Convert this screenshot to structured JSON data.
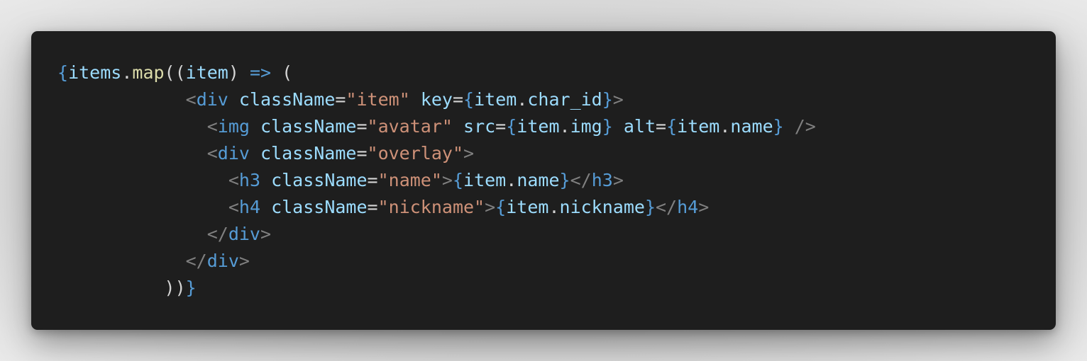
{
  "code_window": {
    "background": "#1e1e1e",
    "language": "jsx",
    "lines": [
      {
        "tokens": [
          {
            "text": "{",
            "type": "brace"
          },
          {
            "text": "items",
            "type": "var"
          },
          {
            "text": ".",
            "type": "punc"
          },
          {
            "text": "map",
            "type": "fn"
          },
          {
            "text": "((",
            "type": "punc"
          },
          {
            "text": "item",
            "type": "var"
          },
          {
            "text": ") ",
            "type": "punc"
          },
          {
            "text": "=>",
            "type": "arrow"
          },
          {
            "text": " (",
            "type": "punc"
          }
        ]
      },
      {
        "tokens": [
          {
            "text": "            ",
            "type": "ws"
          },
          {
            "text": "<",
            "type": "bracket"
          },
          {
            "text": "div",
            "type": "tag"
          },
          {
            "text": " ",
            "type": "ws"
          },
          {
            "text": "className",
            "type": "attr"
          },
          {
            "text": "=",
            "type": "punc"
          },
          {
            "text": "\"item\"",
            "type": "str"
          },
          {
            "text": " ",
            "type": "ws"
          },
          {
            "text": "key",
            "type": "attr"
          },
          {
            "text": "=",
            "type": "punc"
          },
          {
            "text": "{",
            "type": "brace"
          },
          {
            "text": "item",
            "type": "var"
          },
          {
            "text": ".",
            "type": "punc"
          },
          {
            "text": "char_id",
            "type": "var"
          },
          {
            "text": "}",
            "type": "brace"
          },
          {
            "text": ">",
            "type": "bracket"
          }
        ]
      },
      {
        "tokens": [
          {
            "text": "              ",
            "type": "ws"
          },
          {
            "text": "<",
            "type": "bracket"
          },
          {
            "text": "img",
            "type": "tag"
          },
          {
            "text": " ",
            "type": "ws"
          },
          {
            "text": "className",
            "type": "attr"
          },
          {
            "text": "=",
            "type": "punc"
          },
          {
            "text": "\"avatar\"",
            "type": "str"
          },
          {
            "text": " ",
            "type": "ws"
          },
          {
            "text": "src",
            "type": "attr"
          },
          {
            "text": "=",
            "type": "punc"
          },
          {
            "text": "{",
            "type": "brace"
          },
          {
            "text": "item",
            "type": "var"
          },
          {
            "text": ".",
            "type": "punc"
          },
          {
            "text": "img",
            "type": "var"
          },
          {
            "text": "}",
            "type": "brace"
          },
          {
            "text": " ",
            "type": "ws"
          },
          {
            "text": "alt",
            "type": "attr"
          },
          {
            "text": "=",
            "type": "punc"
          },
          {
            "text": "{",
            "type": "brace"
          },
          {
            "text": "item",
            "type": "var"
          },
          {
            "text": ".",
            "type": "punc"
          },
          {
            "text": "name",
            "type": "var"
          },
          {
            "text": "}",
            "type": "brace"
          },
          {
            "text": " />",
            "type": "bracket"
          }
        ]
      },
      {
        "tokens": [
          {
            "text": "              ",
            "type": "ws"
          },
          {
            "text": "<",
            "type": "bracket"
          },
          {
            "text": "div",
            "type": "tag"
          },
          {
            "text": " ",
            "type": "ws"
          },
          {
            "text": "className",
            "type": "attr"
          },
          {
            "text": "=",
            "type": "punc"
          },
          {
            "text": "\"overlay\"",
            "type": "str"
          },
          {
            "text": ">",
            "type": "bracket"
          }
        ]
      },
      {
        "tokens": [
          {
            "text": "                ",
            "type": "ws"
          },
          {
            "text": "<",
            "type": "bracket"
          },
          {
            "text": "h3",
            "type": "tag"
          },
          {
            "text": " ",
            "type": "ws"
          },
          {
            "text": "className",
            "type": "attr"
          },
          {
            "text": "=",
            "type": "punc"
          },
          {
            "text": "\"name\"",
            "type": "str"
          },
          {
            "text": ">",
            "type": "bracket"
          },
          {
            "text": "{",
            "type": "brace"
          },
          {
            "text": "item",
            "type": "var"
          },
          {
            "text": ".",
            "type": "punc"
          },
          {
            "text": "name",
            "type": "var"
          },
          {
            "text": "}",
            "type": "brace"
          },
          {
            "text": "</",
            "type": "bracket"
          },
          {
            "text": "h3",
            "type": "tag"
          },
          {
            "text": ">",
            "type": "bracket"
          }
        ]
      },
      {
        "tokens": [
          {
            "text": "                ",
            "type": "ws"
          },
          {
            "text": "<",
            "type": "bracket"
          },
          {
            "text": "h4",
            "type": "tag"
          },
          {
            "text": " ",
            "type": "ws"
          },
          {
            "text": "className",
            "type": "attr"
          },
          {
            "text": "=",
            "type": "punc"
          },
          {
            "text": "\"nickname\"",
            "type": "str"
          },
          {
            "text": ">",
            "type": "bracket"
          },
          {
            "text": "{",
            "type": "brace"
          },
          {
            "text": "item",
            "type": "var"
          },
          {
            "text": ".",
            "type": "punc"
          },
          {
            "text": "nickname",
            "type": "var"
          },
          {
            "text": "}",
            "type": "brace"
          },
          {
            "text": "</",
            "type": "bracket"
          },
          {
            "text": "h4",
            "type": "tag"
          },
          {
            "text": ">",
            "type": "bracket"
          }
        ]
      },
      {
        "tokens": [
          {
            "text": "              ",
            "type": "ws"
          },
          {
            "text": "</",
            "type": "bracket"
          },
          {
            "text": "div",
            "type": "tag"
          },
          {
            "text": ">",
            "type": "bracket"
          }
        ]
      },
      {
        "tokens": [
          {
            "text": "            ",
            "type": "ws"
          },
          {
            "text": "</",
            "type": "bracket"
          },
          {
            "text": "div",
            "type": "tag"
          },
          {
            "text": ">",
            "type": "bracket"
          }
        ]
      },
      {
        "tokens": [
          {
            "text": "          ",
            "type": "ws"
          },
          {
            "text": "))",
            "type": "punc"
          },
          {
            "text": "}",
            "type": "brace"
          }
        ]
      }
    ]
  },
  "colors": {
    "page_background": "#d4d4d4",
    "code_background": "#1e1e1e",
    "brace": "#569cd6",
    "variable": "#9cdcfe",
    "function": "#dcdcaa",
    "punctuation": "#d4d4d4",
    "tag": "#569cd6",
    "bracket": "#808080",
    "attribute": "#9cdcfe",
    "string": "#ce9178"
  }
}
